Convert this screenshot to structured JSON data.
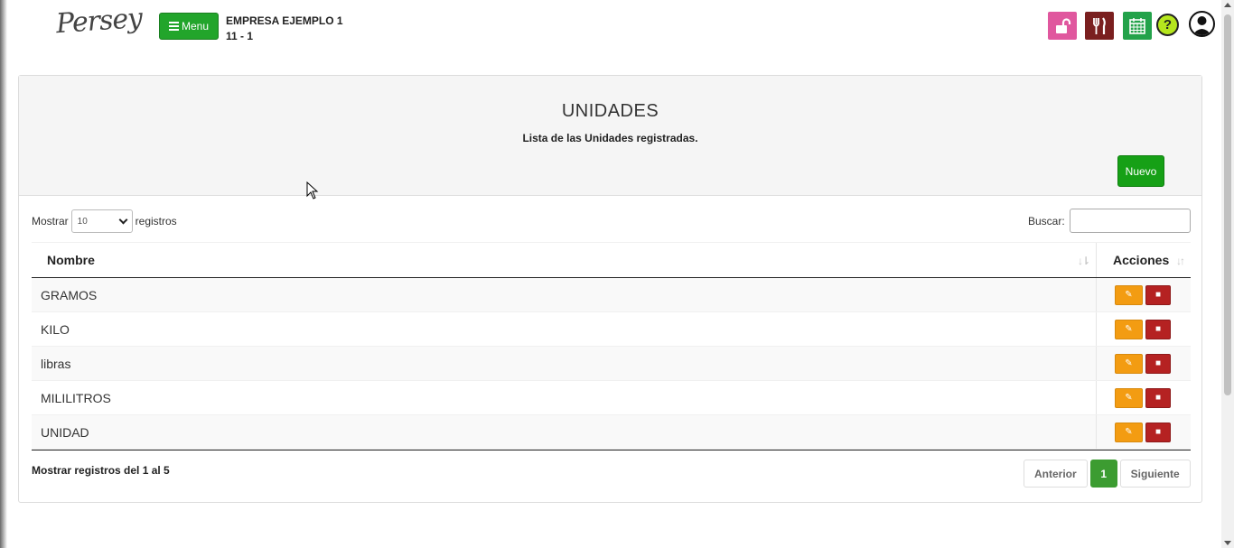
{
  "header": {
    "logo": "Persey",
    "menu_label": "Menu",
    "company_name": "EMPRESA EJEMPLO 1",
    "company_sub": "11 - 1",
    "toolbar_icons": [
      "unlock-icon",
      "utensils-icon",
      "calendar-icon",
      "help-icon",
      "user-icon"
    ],
    "help_glyph": "?"
  },
  "page": {
    "title": "UNIDADES",
    "subtitle": "Lista de las Unidades registradas.",
    "new_button": "Nuevo"
  },
  "table_controls": {
    "show_label": "Mostrar",
    "page_length": "10",
    "records_label": "registros",
    "search_label": "Buscar:",
    "search_value": ""
  },
  "table": {
    "columns": [
      "Nombre",
      "Acciones"
    ],
    "rows": [
      {
        "name": "GRAMOS"
      },
      {
        "name": "KILO"
      },
      {
        "name": "libras"
      },
      {
        "name": "MILILITROS"
      },
      {
        "name": "UNIDAD"
      }
    ]
  },
  "footer": {
    "info": "Mostrar registros del 1 al 5",
    "prev": "Anterior",
    "page": "1",
    "next": "Siguiente"
  },
  "colors": {
    "primary_green": "#22a52b",
    "edit_orange": "#f39c12",
    "delete_red": "#b52222",
    "lock_pink": "#e0579e",
    "food_maroon": "#7a1f1f",
    "calendar_green": "#23a24a"
  }
}
